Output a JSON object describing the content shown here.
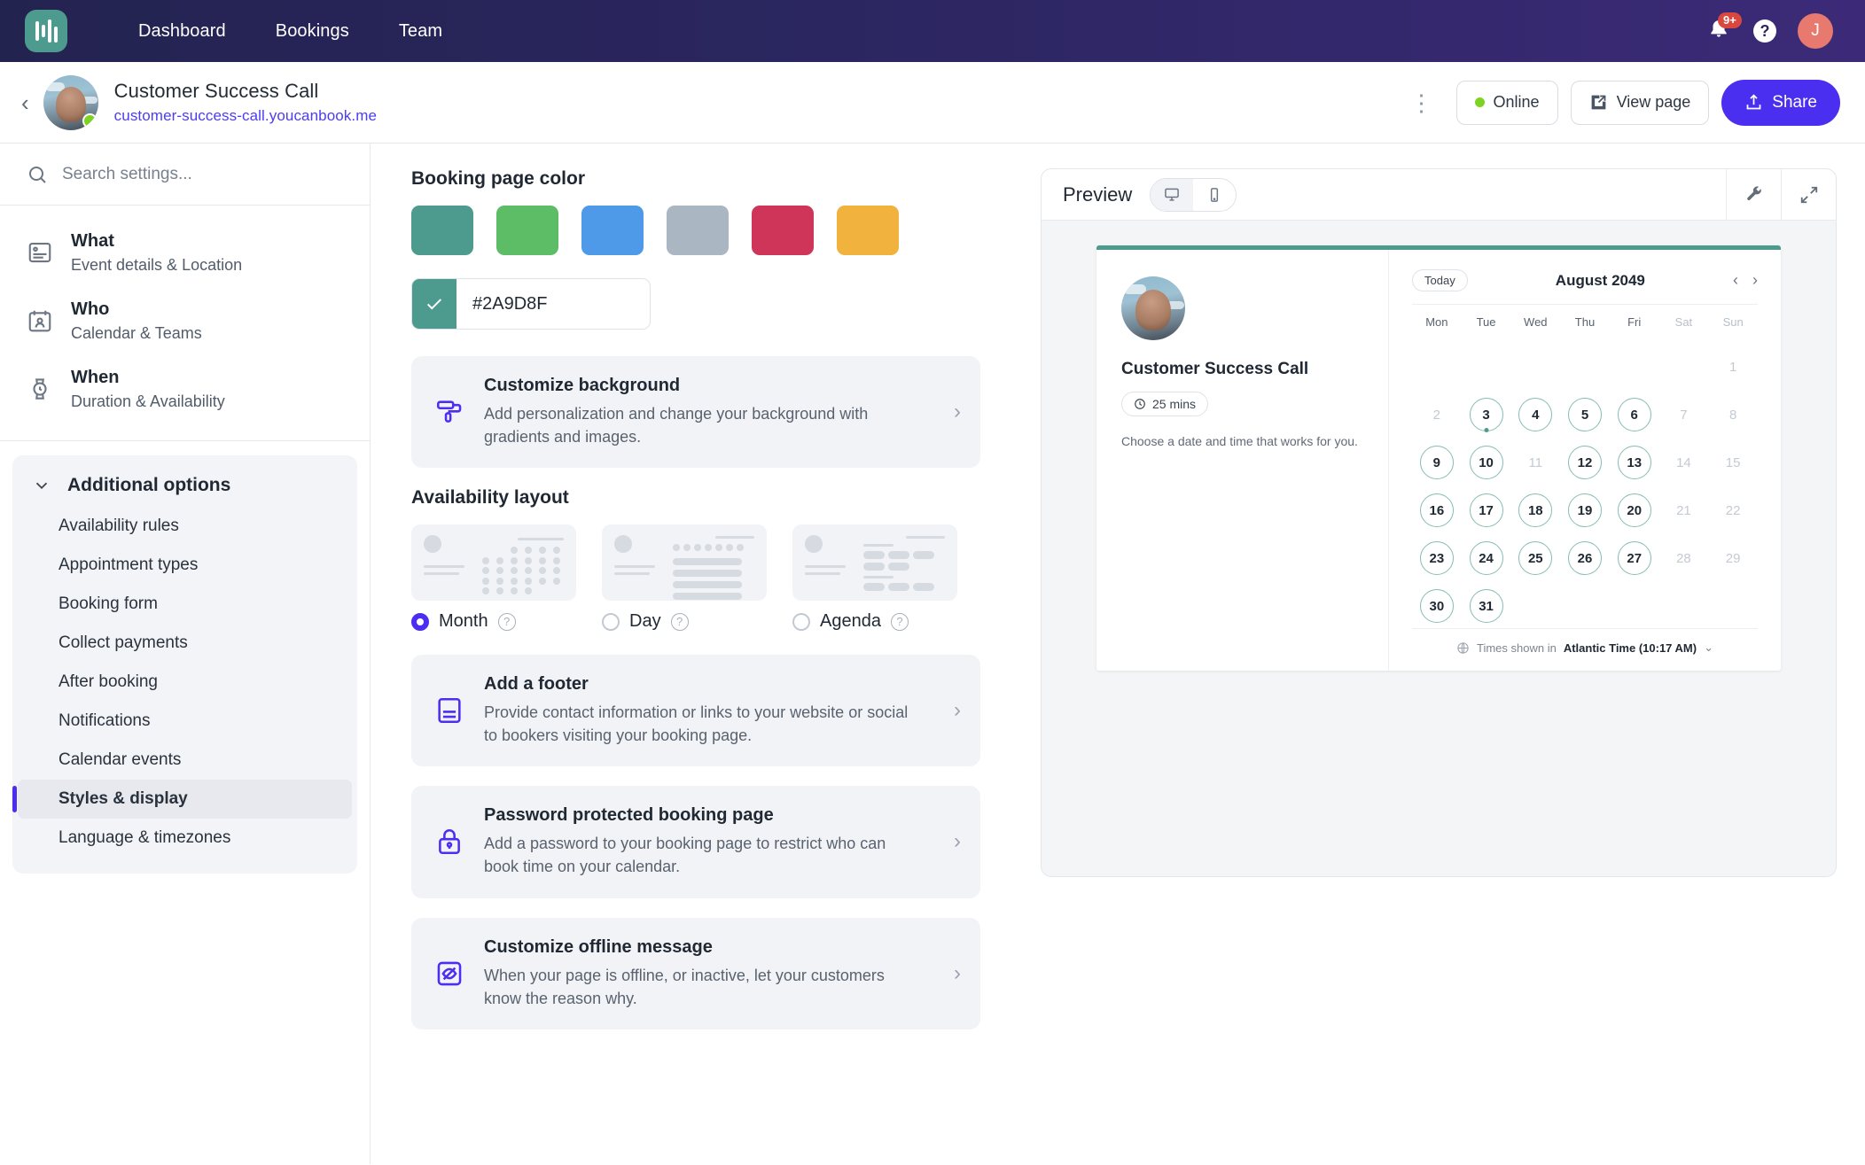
{
  "topnav": {
    "logo_name": "youcanbookme-logo",
    "links": [
      {
        "label": "Dashboard",
        "name": "nav-dashboard"
      },
      {
        "label": "Bookings",
        "name": "nav-bookings"
      },
      {
        "label": "Team",
        "name": "nav-team"
      }
    ],
    "notification_badge": "9+",
    "help_label": "?",
    "avatar_initial": "J"
  },
  "subheader": {
    "title": "Customer Success Call",
    "url": "customer-success-call.youcanbook.me",
    "kebab": "⋮",
    "status_label": "Online",
    "view_page_label": "View page",
    "share_label": "Share"
  },
  "sidebar": {
    "search_placeholder": "Search settings...",
    "main_items": [
      {
        "title": "What",
        "sub": "Event details & Location"
      },
      {
        "title": "Who",
        "sub": "Calendar & Teams"
      },
      {
        "title": "When",
        "sub": "Duration & Availability"
      }
    ],
    "additional_title": "Additional options",
    "options": [
      {
        "label": "Availability rules",
        "active": false
      },
      {
        "label": "Appointment types",
        "active": false
      },
      {
        "label": "Booking form",
        "active": false
      },
      {
        "label": "Collect payments",
        "active": false
      },
      {
        "label": "After booking",
        "active": false
      },
      {
        "label": "Notifications",
        "active": false
      },
      {
        "label": "Calendar events",
        "active": false
      },
      {
        "label": "Styles & display",
        "active": true
      },
      {
        "label": "Language & timezones",
        "active": false
      }
    ]
  },
  "styles_panel": {
    "color_section_title": "Booking page color",
    "swatches": [
      "#4d9b8f",
      "#5cbd66",
      "#4e9ae8",
      "#aab6c1",
      "#cf3459",
      "#f2b23e"
    ],
    "selected_color": "#2A9D8F",
    "selected_swatch_color": "#4d9b8f",
    "customize_background": {
      "title": "Customize background",
      "desc": "Add personalization and change your background with gradients and images.",
      "icon": "paint-roller-icon"
    },
    "layout_section_title": "Availability layout",
    "layouts": [
      {
        "label": "Month",
        "selected": true
      },
      {
        "label": "Day",
        "selected": false
      },
      {
        "label": "Agenda",
        "selected": false
      }
    ],
    "cards": [
      {
        "title": "Add a footer",
        "desc": "Provide contact information or links to your website or social to bookers visiting your booking page.",
        "icon": "footer-icon"
      },
      {
        "title": "Password protected booking page",
        "desc": "Add a password to your booking page to restrict who can book time on your calendar.",
        "icon": "lock-icon"
      },
      {
        "title": "Customize offline message",
        "desc": "When your page is offline, or inactive, let your customers know the reason why.",
        "icon": "eye-off-icon"
      }
    ]
  },
  "preview": {
    "title": "Preview",
    "device_desktop": "desktop-icon",
    "device_mobile": "mobile-icon",
    "tool_wrench": "wrench-icon",
    "tool_expand": "expand-icon",
    "booking_page": {
      "event_title": "Customer Success Call",
      "duration": "25 mins",
      "instruction": "Choose a date and time that works for you.",
      "accent_color": "#4d9b8f"
    },
    "calendar": {
      "today_label": "Today",
      "month_label": "August 2049",
      "prev": "‹",
      "next": "›",
      "weekdays": [
        "Mon",
        "Tue",
        "Wed",
        "Thu",
        "Fri",
        "Sat",
        "Sun"
      ],
      "weekend_indexes": [
        5,
        6
      ],
      "leading_blanks": 6,
      "days": [
        {
          "n": 1,
          "state": "disabled"
        },
        {
          "n": 2,
          "state": "disabled"
        },
        {
          "n": 3,
          "state": "available",
          "dot": true
        },
        {
          "n": 4,
          "state": "available"
        },
        {
          "n": 5,
          "state": "available"
        },
        {
          "n": 6,
          "state": "available"
        },
        {
          "n": 7,
          "state": "disabled"
        },
        {
          "n": 8,
          "state": "disabled"
        },
        {
          "n": 9,
          "state": "available"
        },
        {
          "n": 10,
          "state": "available"
        },
        {
          "n": 11,
          "state": "disabled"
        },
        {
          "n": 12,
          "state": "available"
        },
        {
          "n": 13,
          "state": "available"
        },
        {
          "n": 14,
          "state": "disabled"
        },
        {
          "n": 15,
          "state": "disabled"
        },
        {
          "n": 16,
          "state": "available"
        },
        {
          "n": 17,
          "state": "available"
        },
        {
          "n": 18,
          "state": "available"
        },
        {
          "n": 19,
          "state": "available"
        },
        {
          "n": 20,
          "state": "available"
        },
        {
          "n": 21,
          "state": "disabled"
        },
        {
          "n": 22,
          "state": "disabled"
        },
        {
          "n": 23,
          "state": "available"
        },
        {
          "n": 24,
          "state": "available"
        },
        {
          "n": 25,
          "state": "available"
        },
        {
          "n": 26,
          "state": "available"
        },
        {
          "n": 27,
          "state": "available"
        },
        {
          "n": 28,
          "state": "disabled"
        },
        {
          "n": 29,
          "state": "disabled"
        },
        {
          "n": 30,
          "state": "available"
        },
        {
          "n": 31,
          "state": "available"
        }
      ],
      "tz_prefix": "Times shown in",
      "tz_value": "Atlantic Time (10:17 AM)",
      "tz_caret": "⌄"
    }
  }
}
